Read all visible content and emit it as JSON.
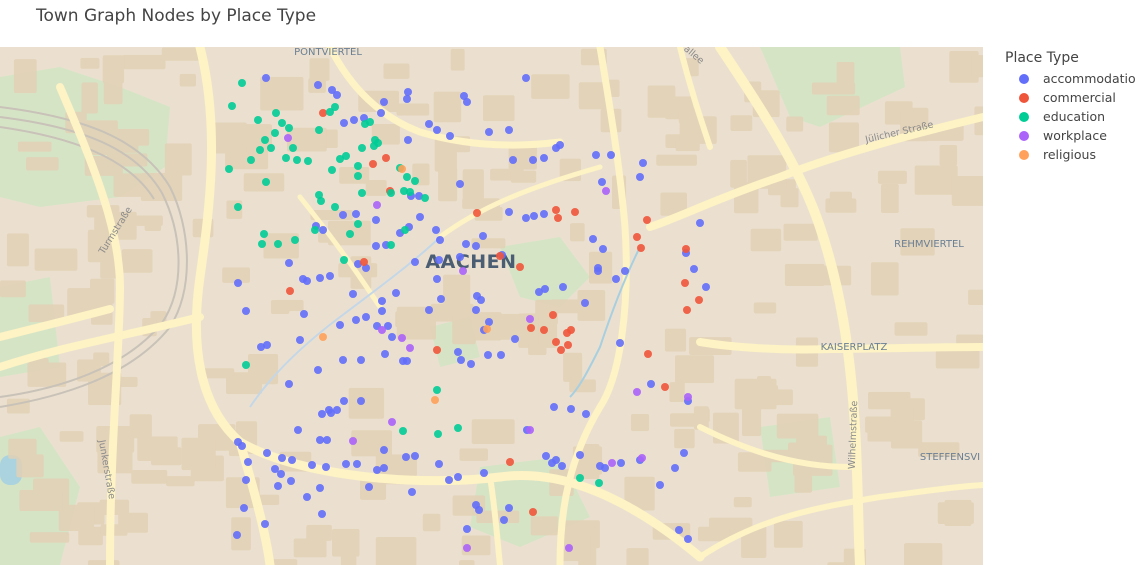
{
  "title": "Town Graph Nodes by Place Type",
  "legend_title": "Place Type",
  "categories": [
    {
      "key": "accommodation",
      "label": "accommodation",
      "color": "#636efa"
    },
    {
      "key": "commercial",
      "label": "commercial",
      "color": "#ef553b"
    },
    {
      "key": "education",
      "label": "education",
      "color": "#00cc96"
    },
    {
      "key": "workplace",
      "label": "workplace",
      "color": "#ab63fa"
    },
    {
      "key": "religious",
      "label": "religious",
      "color": "#ffa15a"
    }
  ],
  "map": {
    "city_label": "AACHEN",
    "districts": [
      "PONTVIERTEL",
      "REHMVIERTEL",
      "KAISERPLATZ",
      "STEFFENSVI"
    ],
    "streets": [
      "Turmstraße",
      "Junkerstraße",
      "Jülicher Straße",
      "Wilhelmstraße",
      "allee"
    ]
  },
  "chart_data": {
    "type": "scatter",
    "title": "Town Graph Nodes by Place Type",
    "legend_title": "Place Type",
    "legend_position": "right",
    "series": [
      {
        "name": "accommodation",
        "color": "#636efa",
        "points": [
          [
            266,
            78
          ],
          [
            318,
            85
          ],
          [
            332,
            90
          ],
          [
            337,
            95
          ],
          [
            381,
            113
          ],
          [
            384,
            102
          ],
          [
            408,
            92
          ],
          [
            407,
            99
          ],
          [
            464,
            96
          ],
          [
            467,
            102
          ],
          [
            526,
            78
          ],
          [
            429,
            124
          ],
          [
            437,
            130
          ],
          [
            450,
            136
          ],
          [
            489,
            132
          ],
          [
            509,
            130
          ],
          [
            560,
            145
          ],
          [
            556,
            148
          ],
          [
            596,
            155
          ],
          [
            611,
            155
          ],
          [
            643,
            163
          ],
          [
            640,
            177
          ],
          [
            602,
            182
          ],
          [
            544,
            158
          ],
          [
            533,
            160
          ],
          [
            513,
            160
          ],
          [
            408,
            140
          ],
          [
            364,
            118
          ],
          [
            354,
            120
          ],
          [
            344,
            123
          ],
          [
            460,
            184
          ],
          [
            419,
            196
          ],
          [
            436,
            230
          ],
          [
            440,
            240
          ],
          [
            476,
            246
          ],
          [
            483,
            236
          ],
          [
            509,
            212
          ],
          [
            526,
            218
          ],
          [
            534,
            216
          ],
          [
            544,
            214
          ],
          [
            593,
            239
          ],
          [
            603,
            249
          ],
          [
            598,
            271
          ],
          [
            598,
            268
          ],
          [
            625,
            271
          ],
          [
            616,
            279
          ],
          [
            585,
            303
          ],
          [
            563,
            287
          ],
          [
            545,
            289
          ],
          [
            539,
            292
          ],
          [
            502,
            255
          ],
          [
            466,
            244
          ],
          [
            460,
            257
          ],
          [
            439,
            260
          ],
          [
            415,
            262
          ],
          [
            437,
            279
          ],
          [
            441,
            299
          ],
          [
            477,
            296
          ],
          [
            476,
            310
          ],
          [
            481,
            300
          ],
          [
            489,
            322
          ],
          [
            484,
            330
          ],
          [
            515,
            339
          ],
          [
            501,
            355
          ],
          [
            488,
            355
          ],
          [
            471,
            364
          ],
          [
            461,
            360
          ],
          [
            458,
            352
          ],
          [
            429,
            310
          ],
          [
            396,
            293
          ],
          [
            382,
            301
          ],
          [
            382,
            311
          ],
          [
            377,
            326
          ],
          [
            388,
            326
          ],
          [
            392,
            337
          ],
          [
            385,
            354
          ],
          [
            403,
            361
          ],
          [
            407,
            361
          ],
          [
            353,
            294
          ],
          [
            358,
            264
          ],
          [
            366,
            268
          ],
          [
            376,
            246
          ],
          [
            386,
            245
          ],
          [
            400,
            233
          ],
          [
            409,
            227
          ],
          [
            411,
            196
          ],
          [
            420,
            217
          ],
          [
            376,
            220
          ],
          [
            356,
            214
          ],
          [
            316,
            226
          ],
          [
            323,
            230
          ],
          [
            343,
            215
          ],
          [
            330,
            276
          ],
          [
            320,
            278
          ],
          [
            307,
            281
          ],
          [
            289,
            263
          ],
          [
            303,
            279
          ],
          [
            304,
            314
          ],
          [
            340,
            325
          ],
          [
            356,
            320
          ],
          [
            366,
            317
          ],
          [
            361,
            360
          ],
          [
            343,
            360
          ],
          [
            318,
            370
          ],
          [
            289,
            384
          ],
          [
            300,
            340
          ],
          [
            261,
            347
          ],
          [
            267,
            345
          ],
          [
            246,
            311
          ],
          [
            238,
            283
          ],
          [
            238,
            442
          ],
          [
            242,
            446
          ],
          [
            248,
            462
          ],
          [
            267,
            453
          ],
          [
            282,
            458
          ],
          [
            292,
            460
          ],
          [
            246,
            480
          ],
          [
            275,
            469
          ],
          [
            281,
            474
          ],
          [
            278,
            486
          ],
          [
            291,
            481
          ],
          [
            307,
            497
          ],
          [
            320,
            488
          ],
          [
            312,
            465
          ],
          [
            326,
            467
          ],
          [
            346,
            464
          ],
          [
            357,
            464
          ],
          [
            377,
            470
          ],
          [
            384,
            468
          ],
          [
            384,
            450
          ],
          [
            406,
            457
          ],
          [
            415,
            456
          ],
          [
            439,
            464
          ],
          [
            458,
            477
          ],
          [
            449,
            480
          ],
          [
            484,
            473
          ],
          [
            476,
            505
          ],
          [
            479,
            510
          ],
          [
            412,
            492
          ],
          [
            369,
            487
          ],
          [
            322,
            514
          ],
          [
            320,
            440
          ],
          [
            327,
            440
          ],
          [
            331,
            413
          ],
          [
            322,
            414
          ],
          [
            329,
            410
          ],
          [
            337,
            410
          ],
          [
            344,
            401
          ],
          [
            361,
            401
          ],
          [
            298,
            430
          ],
          [
            244,
            508
          ],
          [
            265,
            524
          ],
          [
            237,
            535
          ],
          [
            467,
            529
          ],
          [
            509,
            508
          ],
          [
            504,
            520
          ],
          [
            554,
            407
          ],
          [
            571,
            409
          ],
          [
            586,
            414
          ],
          [
            527,
            430
          ],
          [
            546,
            456
          ],
          [
            552,
            463
          ],
          [
            556,
            460
          ],
          [
            562,
            466
          ],
          [
            580,
            455
          ],
          [
            605,
            468
          ],
          [
            600,
            466
          ],
          [
            621,
            463
          ],
          [
            640,
            460
          ],
          [
            620,
            343
          ],
          [
            651,
            384
          ],
          [
            660,
            485
          ],
          [
            675,
            468
          ],
          [
            684,
            453
          ],
          [
            688,
            401
          ],
          [
            679,
            530
          ],
          [
            688,
            539
          ],
          [
            700,
            223
          ],
          [
            686,
            253
          ],
          [
            694,
            269
          ],
          [
            706,
            287
          ]
        ]
      },
      {
        "name": "commercial",
        "color": "#ef553b",
        "points": [
          [
            323,
            113
          ],
          [
            373,
            164
          ],
          [
            386,
            158
          ],
          [
            390,
            191
          ],
          [
            477,
            213
          ],
          [
            500,
            256
          ],
          [
            520,
            267
          ],
          [
            556,
            210
          ],
          [
            558,
            218
          ],
          [
            575,
            212
          ],
          [
            637,
            237
          ],
          [
            647,
            220
          ],
          [
            641,
            248
          ],
          [
            686,
            249
          ],
          [
            685,
            283
          ],
          [
            699,
            300
          ],
          [
            687,
            310
          ],
          [
            553,
            315
          ],
          [
            531,
            328
          ],
          [
            544,
            330
          ],
          [
            567,
            333
          ],
          [
            571,
            330
          ],
          [
            556,
            342
          ],
          [
            561,
            350
          ],
          [
            568,
            345
          ],
          [
            437,
            350
          ],
          [
            364,
            262
          ],
          [
            290,
            291
          ],
          [
            510,
            462
          ],
          [
            533,
            512
          ],
          [
            648,
            354
          ],
          [
            665,
            387
          ]
        ]
      },
      {
        "name": "education",
        "color": "#00cc96",
        "points": [
          [
            242,
            83
          ],
          [
            232,
            106
          ],
          [
            258,
            120
          ],
          [
            276,
            113
          ],
          [
            282,
            123
          ],
          [
            289,
            128
          ],
          [
            275,
            133
          ],
          [
            265,
            140
          ],
          [
            260,
            150
          ],
          [
            271,
            148
          ],
          [
            293,
            148
          ],
          [
            297,
            160
          ],
          [
            286,
            158
          ],
          [
            319,
            130
          ],
          [
            330,
            112
          ],
          [
            335,
            107
          ],
          [
            365,
            124
          ],
          [
            370,
            122
          ],
          [
            362,
            148
          ],
          [
            375,
            140
          ],
          [
            374,
            146
          ],
          [
            378,
            143
          ],
          [
            346,
            156
          ],
          [
            340,
            159
          ],
          [
            358,
            166
          ],
          [
            332,
            170
          ],
          [
            358,
            176
          ],
          [
            229,
            169
          ],
          [
            266,
            182
          ],
          [
            251,
            160
          ],
          [
            308,
            161
          ],
          [
            400,
            168
          ],
          [
            407,
            177
          ],
          [
            415,
            181
          ],
          [
            404,
            191
          ],
          [
            410,
            192
          ],
          [
            391,
            193
          ],
          [
            362,
            193
          ],
          [
            425,
            198
          ],
          [
            319,
            195
          ],
          [
            321,
            201
          ],
          [
            335,
            207
          ],
          [
            315,
            230
          ],
          [
            350,
            234
          ],
          [
            358,
            224
          ],
          [
            238,
            207
          ],
          [
            264,
            234
          ],
          [
            262,
            244
          ],
          [
            278,
            244
          ],
          [
            295,
            240
          ],
          [
            391,
            245
          ],
          [
            405,
            230
          ],
          [
            344,
            260
          ],
          [
            246,
            365
          ],
          [
            437,
            390
          ],
          [
            438,
            434
          ],
          [
            458,
            428
          ],
          [
            403,
            431
          ],
          [
            580,
            478
          ],
          [
            599,
            483
          ]
        ]
      },
      {
        "name": "workplace",
        "color": "#ab63fa",
        "points": [
          [
            288,
            138
          ],
          [
            377,
            205
          ],
          [
            606,
            191
          ],
          [
            463,
            271
          ],
          [
            530,
            319
          ],
          [
            382,
            330
          ],
          [
            402,
            338
          ],
          [
            410,
            348
          ],
          [
            392,
            422
          ],
          [
            353,
            441
          ],
          [
            530,
            430
          ],
          [
            612,
            463
          ],
          [
            642,
            458
          ],
          [
            637,
            392
          ],
          [
            688,
            397
          ],
          [
            467,
            548
          ],
          [
            569,
            548
          ]
        ]
      },
      {
        "name": "religious",
        "color": "#ffa15a",
        "points": [
          [
            402,
            169
          ],
          [
            323,
            337
          ],
          [
            487,
            329
          ],
          [
            435,
            400
          ]
        ]
      }
    ]
  }
}
